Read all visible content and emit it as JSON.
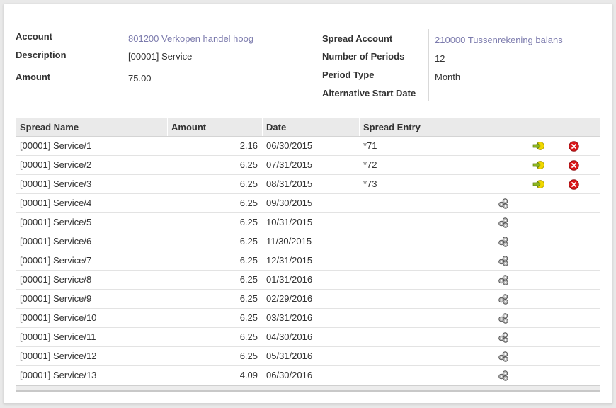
{
  "form": {
    "left": {
      "account_label": "Account",
      "account_value": "801200 Verkopen handel hoog",
      "description_label": "Description",
      "description_value": "[00001] Service",
      "amount_label": "Amount",
      "amount_value": "75.00"
    },
    "right": {
      "spread_account_label": "Spread Account",
      "spread_account_value": "210000 Tussenrekening balans",
      "num_periods_label": "Number of Periods",
      "num_periods_value": "12",
      "period_type_label": "Period Type",
      "period_type_value": "Month",
      "alt_start_label": "Alternative Start Date",
      "alt_start_value": ""
    }
  },
  "table": {
    "headers": {
      "name": "Spread Name",
      "amount": "Amount",
      "date": "Date",
      "entry": "Spread Entry"
    },
    "rows": [
      {
        "name": "[00001] Service/1",
        "amount": "2.16",
        "date": "06/30/2015",
        "entry": "*71",
        "posted": true
      },
      {
        "name": "[00001] Service/2",
        "amount": "6.25",
        "date": "07/31/2015",
        "entry": "*72",
        "posted": true
      },
      {
        "name": "[00001] Service/3",
        "amount": "6.25",
        "date": "08/31/2015",
        "entry": "*73",
        "posted": true
      },
      {
        "name": "[00001] Service/4",
        "amount": "6.25",
        "date": "09/30/2015",
        "entry": "",
        "posted": false
      },
      {
        "name": "[00001] Service/5",
        "amount": "6.25",
        "date": "10/31/2015",
        "entry": "",
        "posted": false
      },
      {
        "name": "[00001] Service/6",
        "amount": "6.25",
        "date": "11/30/2015",
        "entry": "",
        "posted": false
      },
      {
        "name": "[00001] Service/7",
        "amount": "6.25",
        "date": "12/31/2015",
        "entry": "",
        "posted": false
      },
      {
        "name": "[00001] Service/8",
        "amount": "6.25",
        "date": "01/31/2016",
        "entry": "",
        "posted": false
      },
      {
        "name": "[00001] Service/9",
        "amount": "6.25",
        "date": "02/29/2016",
        "entry": "",
        "posted": false
      },
      {
        "name": "[00001] Service/10",
        "amount": "6.25",
        "date": "03/31/2016",
        "entry": "",
        "posted": false
      },
      {
        "name": "[00001] Service/11",
        "amount": "6.25",
        "date": "04/30/2016",
        "entry": "",
        "posted": false
      },
      {
        "name": "[00001] Service/12",
        "amount": "6.25",
        "date": "05/31/2016",
        "entry": "",
        "posted": false
      },
      {
        "name": "[00001] Service/13",
        "amount": "4.09",
        "date": "06/30/2016",
        "entry": "",
        "posted": false
      }
    ]
  },
  "icons": {
    "create_move": "gear-cluster-icon",
    "open_move": "arrow-right-icon",
    "unlink": "delete-circle-icon"
  },
  "colors": {
    "link": "#7c7bad",
    "delete": "#d9181b",
    "open": "#8cb520",
    "header_bg": "#eaeaea"
  }
}
